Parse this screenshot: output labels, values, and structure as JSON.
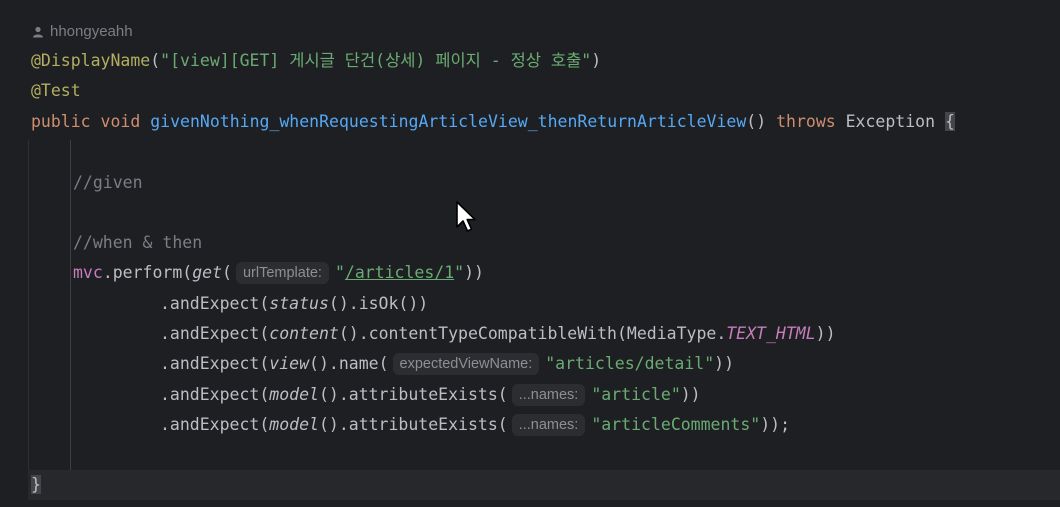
{
  "author": "hhongyeahh",
  "code": {
    "line1": {
      "ann": "@DisplayName",
      "open": "(",
      "str": "\"[view][GET] 게시글 단건(상세) 페이지 - 정상 호출\"",
      "close": ")"
    },
    "line2": {
      "ann": "@Test"
    },
    "line3": {
      "kw1": "public",
      "kw2": "void",
      "method": "givenNothing_whenRequestingArticleView_thenReturnArticleView",
      "parens": "()",
      "kw3": "throws",
      "exc": "Exception",
      "brace": "{"
    },
    "line4": {
      "comment": "//given"
    },
    "line5": {
      "comment": "//when & then"
    },
    "line6": {
      "var": "mvc",
      "perform": ".perform(",
      "get": "get",
      "open": "(",
      "hint": "urlTemplate:",
      "q1": "\"",
      "path": "/articles/1",
      "q2": "\"",
      "close": "))"
    },
    "line7": {
      "pre": ".andExpect(",
      "fn": "status",
      "post": "().isOk())"
    },
    "line8": {
      "pre": ".andExpect(",
      "fn": "content",
      "mid": "().contentTypeCompatibleWith(MediaType.",
      "field": "TEXT_HTML",
      "post": "))"
    },
    "line9": {
      "pre": ".andExpect(",
      "fn": "view",
      "mid": "().name(",
      "hint": "expectedViewName:",
      "str": "\"articles/detail\"",
      "post": "))"
    },
    "line10": {
      "pre": ".andExpect(",
      "fn": "model",
      "mid": "().attributeExists(",
      "hint": "...names:",
      "str": "\"article\"",
      "post": "))"
    },
    "line11": {
      "pre": ".andExpect(",
      "fn": "model",
      "mid": "().attributeExists(",
      "hint": "...names:",
      "str": "\"articleComments\"",
      "post": "));"
    },
    "line12": {
      "brace": "}"
    }
  },
  "colors": {
    "background": "#1e1f22",
    "annotation": "#b3ae60",
    "keyword": "#cf8e6d",
    "method": "#56a8f5",
    "string": "#6aab73",
    "comment": "#7a7e85",
    "field": "#c77dbb"
  },
  "icons": {
    "author": "person-icon",
    "cursor": "mouse-pointer-icon"
  }
}
